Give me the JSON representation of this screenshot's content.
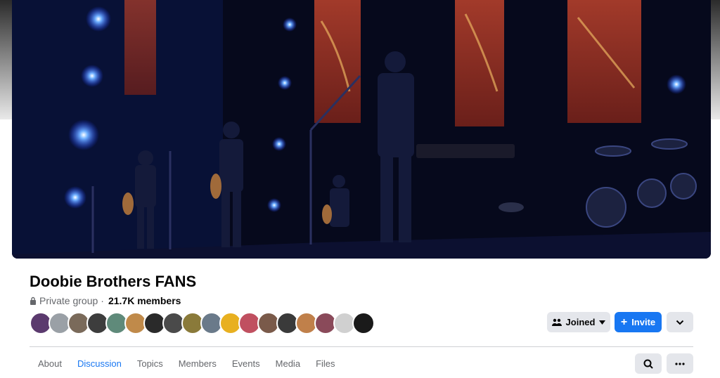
{
  "group": {
    "name": "Doobie Brothers FANS",
    "privacy": "Private group",
    "separator": "·",
    "members": "21.7K members"
  },
  "member_avatar_colors": [
    "#5b3a6e",
    "#9aa0a6",
    "#7a6a5a",
    "#3d3d3d",
    "#5f8a7a",
    "#c08a4a",
    "#2a2a2a",
    "#4a4a4a",
    "#8a7a3a",
    "#6a7a8a",
    "#e8b020",
    "#c05060",
    "#7a5a4a",
    "#3a3a3a",
    "#c0804a",
    "#8a4a5a",
    "#d0d0d0",
    "#1a1a1a"
  ],
  "actions": {
    "joined_label": "Joined",
    "invite_label": "Invite"
  },
  "tabs": [
    {
      "label": "About",
      "active": false
    },
    {
      "label": "Discussion",
      "active": true
    },
    {
      "label": "Topics",
      "active": false
    },
    {
      "label": "Members",
      "active": false
    },
    {
      "label": "Events",
      "active": false
    },
    {
      "label": "Media",
      "active": false
    },
    {
      "label": "Files",
      "active": false
    }
  ],
  "colors": {
    "accent": "#1877f2",
    "button_bg": "#e4e6eb",
    "muted_text": "#65676b"
  }
}
